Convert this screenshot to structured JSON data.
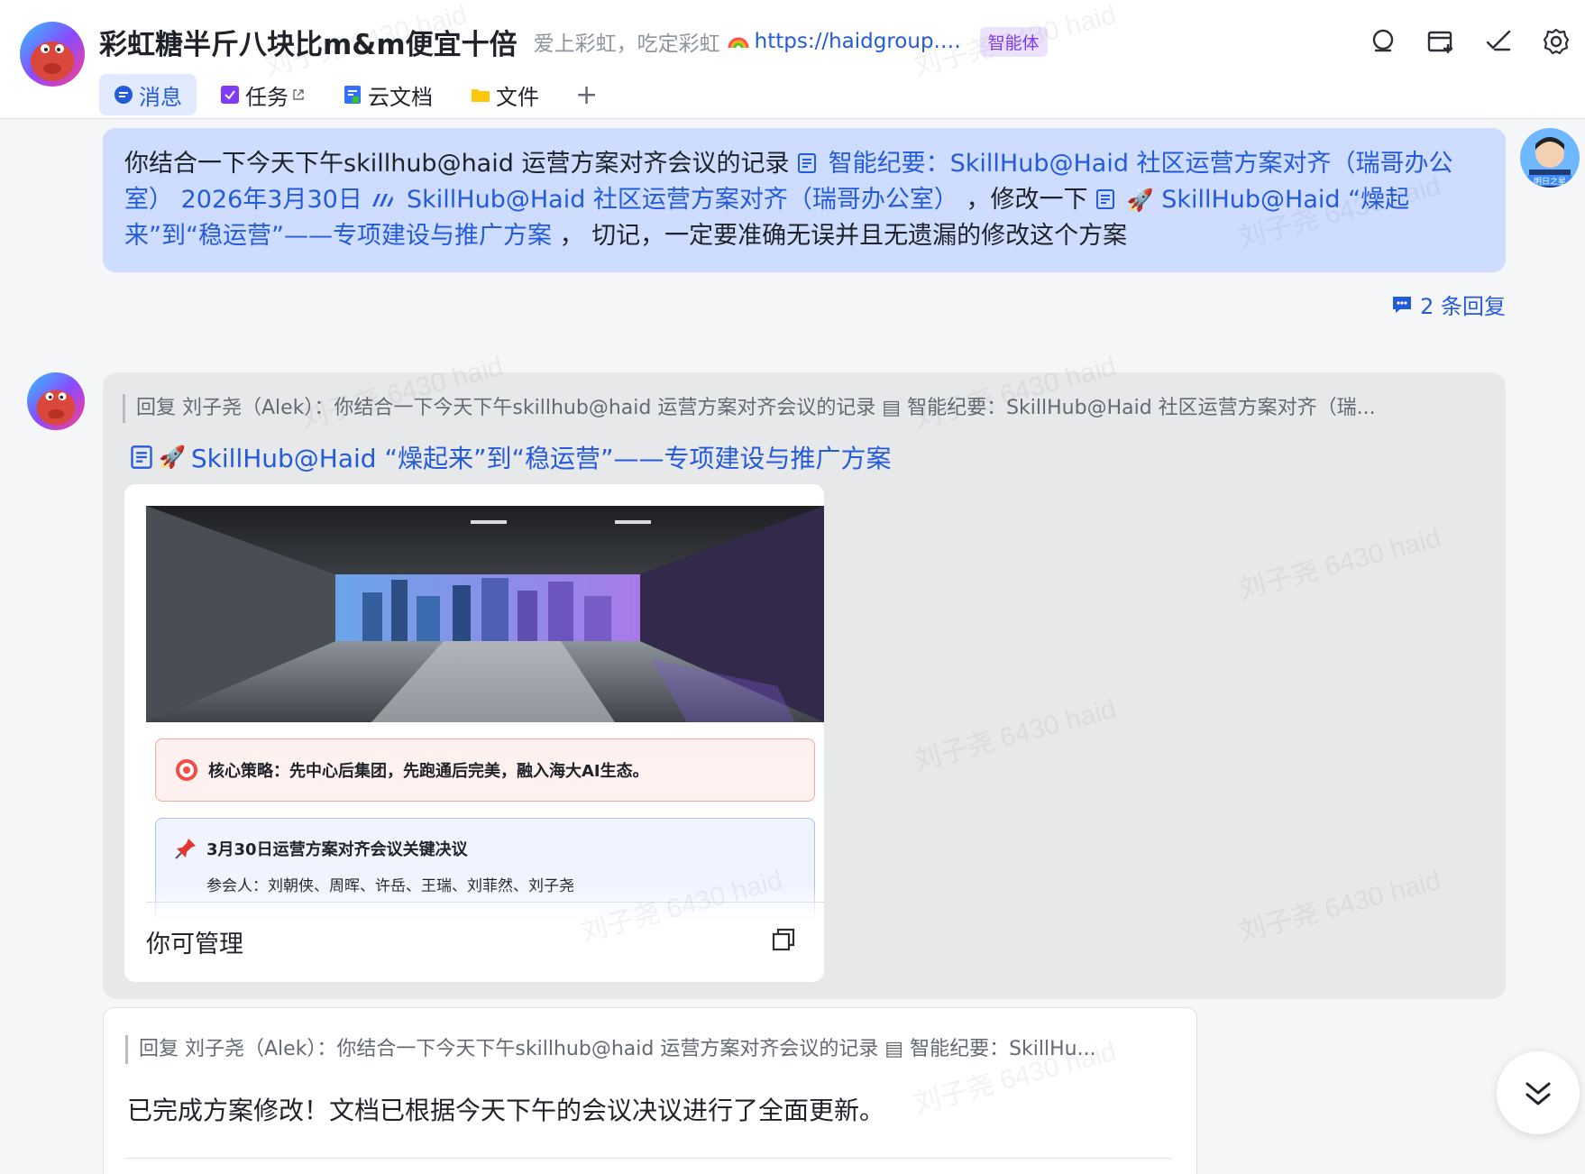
{
  "header": {
    "group_name": "彩虹糖半斤八块比m&m便宜十倍",
    "description": "爱上彩虹，吃定彩虹",
    "link": "https://haidgroup.f...",
    "badge": "智能体",
    "icons": [
      "search-icon",
      "add-window-icon",
      "edit-icon",
      "gear-icon"
    ]
  },
  "tabs": [
    {
      "label": "消息",
      "icon": "chat-icon",
      "active": true
    },
    {
      "label": "任务",
      "icon": "task-icon",
      "external": true
    },
    {
      "label": "云文档",
      "icon": "doc-icon"
    },
    {
      "label": "文件",
      "icon": "folder-icon"
    }
  ],
  "user_message": {
    "part1": "你结合一下今天下午skillhub@haid 运营方案对齐会议的记录",
    "link1": "智能纪要：SkillHub@Haid 社区运营方案对齐（瑞哥办公室） 2026年3月30日",
    "link2": "SkillHub@Haid 社区运营方案对齐（瑞哥办公室）",
    "part2": "，修改一下",
    "link3": "SkillHub@Haid “燥起来”到“稳运营”——专项建设与推广方案",
    "part3": "， 切记，一定要准确无误并且无遗漏的修改这个方案",
    "avatar_badge": "明日之星",
    "replies": "2 条回复"
  },
  "bot_message": {
    "quote": "回复 刘子尧（Alek）：你结合一下今天下午skillhub@haid 运营方案对齐会议的记录 ▤ 智能纪要：SkillHub@Haid 社区运营方案对齐（瑞...",
    "doc_title": "SkillHub@Haid “燥起来”到“稳运营”——专项建设与推广方案",
    "callout1": "核心策略：先中心后集团，先跑通后完美，融入海大AI生态。",
    "callout2_title": "3月30日运营方案对齐会议关键决议",
    "callout2_sub": "参会人：刘朝侠、周晖、许岳、王瑞、刘菲然、刘子尧",
    "footer": "你可管理"
  },
  "bot_reply": {
    "quote": "回复 刘子尧（Alek）：你结合一下今天下午skillhub@haid 运营方案对齐会议的记录 ▤ 智能纪要：SkillHu...",
    "text": "已完成方案修改！文档已根据今天下午的会议决议进行了全面更新。"
  },
  "watermark": "刘子尧 6430 haid",
  "colors": {
    "accent": "#245bdb",
    "user_bubble": "#cddcff",
    "bot_bubble": "#e7e8ea",
    "badge": "#7f3bf5"
  }
}
